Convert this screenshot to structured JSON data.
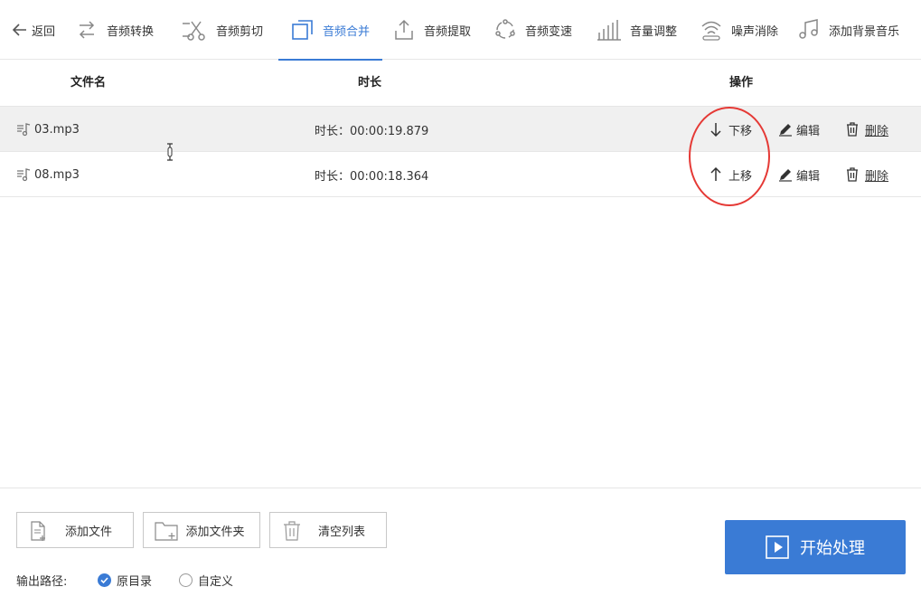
{
  "toolbar": {
    "back_label": "返回",
    "items": [
      {
        "label": "音频转换",
        "icon": "convert-icon"
      },
      {
        "label": "音频剪切",
        "icon": "scissors-icon"
      },
      {
        "label": "音频合并",
        "icon": "merge-icon",
        "active": true
      },
      {
        "label": "音频提取",
        "icon": "upload-icon"
      },
      {
        "label": "音频变速",
        "icon": "speed-icon"
      },
      {
        "label": "音量调整",
        "icon": "volume-bars-icon"
      },
      {
        "label": "噪声消除",
        "icon": "wifi-noise-icon"
      },
      {
        "label": "添加背景音乐",
        "icon": "music-note-icon"
      }
    ]
  },
  "table": {
    "headers": {
      "name": "文件名",
      "duration": "时长",
      "actions": "操作"
    },
    "rows": [
      {
        "name": "03.mp3",
        "duration": "时长：00:00:19.879",
        "move": "下移",
        "edit": "编辑",
        "delete": "删除"
      },
      {
        "name": "08.mp3",
        "duration": "时长：00:00:18.364",
        "move": "上移",
        "edit": "编辑",
        "delete": "删除"
      }
    ]
  },
  "bottom": {
    "add_file": "添加文件",
    "add_folder": "添加文件夹",
    "clear_list": "清空列表",
    "output_label": "输出路径:",
    "radio_original": "原目录",
    "radio_custom": "自定义",
    "start": "开始处理"
  },
  "colors": {
    "accent": "#3a7bd5",
    "highlight_circle": "#e53935"
  }
}
